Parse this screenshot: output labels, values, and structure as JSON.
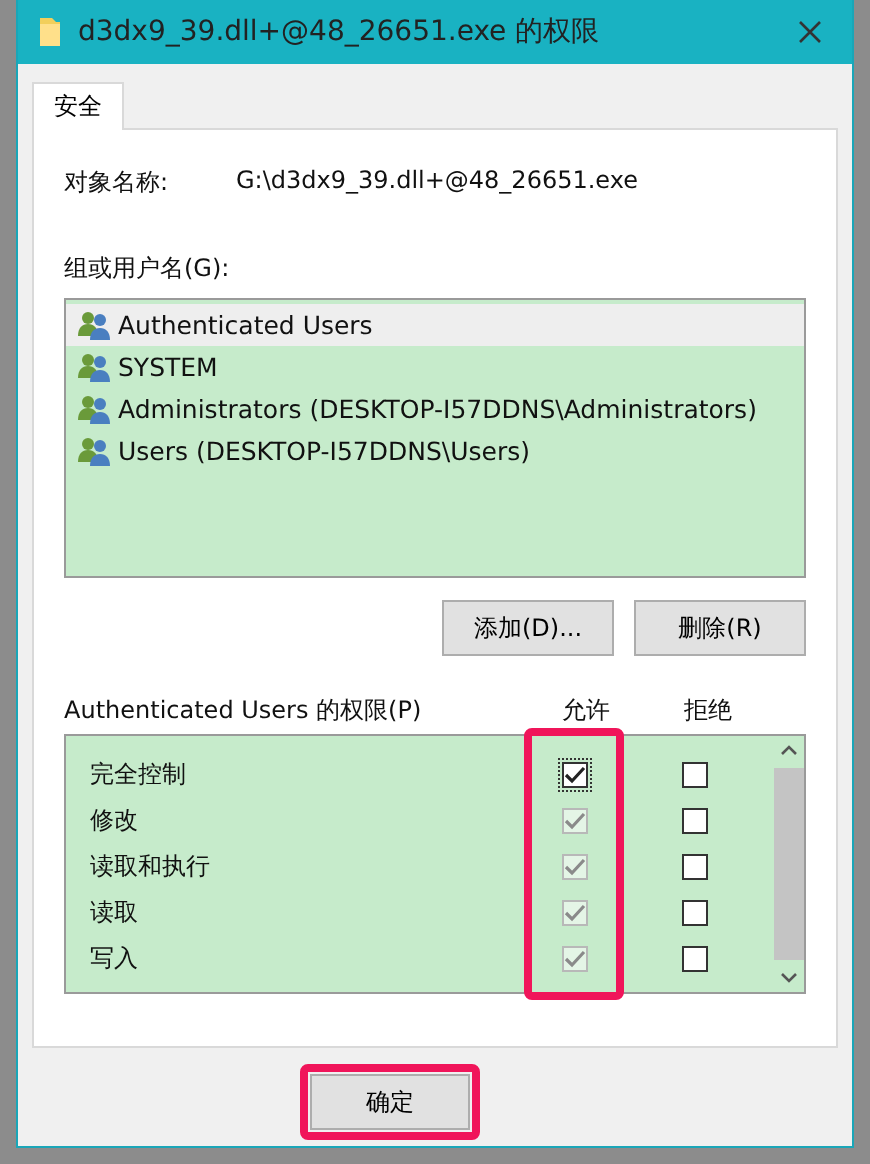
{
  "window": {
    "title": "d3dx9_39.dll+@48_26651.exe 的权限"
  },
  "tabs": [
    {
      "label": "安全",
      "selected": true
    }
  ],
  "object_name": {
    "label": "对象名称:",
    "value": "G:\\d3dx9_39.dll+@48_26651.exe"
  },
  "groups": {
    "label": "组或用户名(G):",
    "items": [
      {
        "name": "Authenticated Users",
        "selected": true
      },
      {
        "name": "SYSTEM",
        "selected": false
      },
      {
        "name": "Administrators (DESKTOP-I57DDNS\\Administrators)",
        "selected": false
      },
      {
        "name": "Users (DESKTOP-I57DDNS\\Users)",
        "selected": false
      }
    ],
    "buttons": [
      "添加(D)...",
      "删除(R)"
    ]
  },
  "permissions": {
    "label": "Authenticated Users 的权限(P)",
    "allow_header": "允许",
    "deny_header": "拒绝",
    "allow_column_highlighted": true,
    "rows": [
      {
        "name": "完全控制",
        "allow_checked": true,
        "allow_disabled": false,
        "deny_checked": false
      },
      {
        "name": "修改",
        "allow_checked": true,
        "allow_disabled": true,
        "deny_checked": false
      },
      {
        "name": "读取和执行",
        "allow_checked": true,
        "allow_disabled": true,
        "deny_checked": false
      },
      {
        "name": "读取",
        "allow_checked": true,
        "allow_disabled": true,
        "deny_checked": false
      },
      {
        "name": "写入",
        "allow_checked": true,
        "allow_disabled": true,
        "deny_checked": false
      }
    ]
  },
  "footer_buttons": [
    {
      "label": "确定",
      "highlighted": true
    }
  ]
}
